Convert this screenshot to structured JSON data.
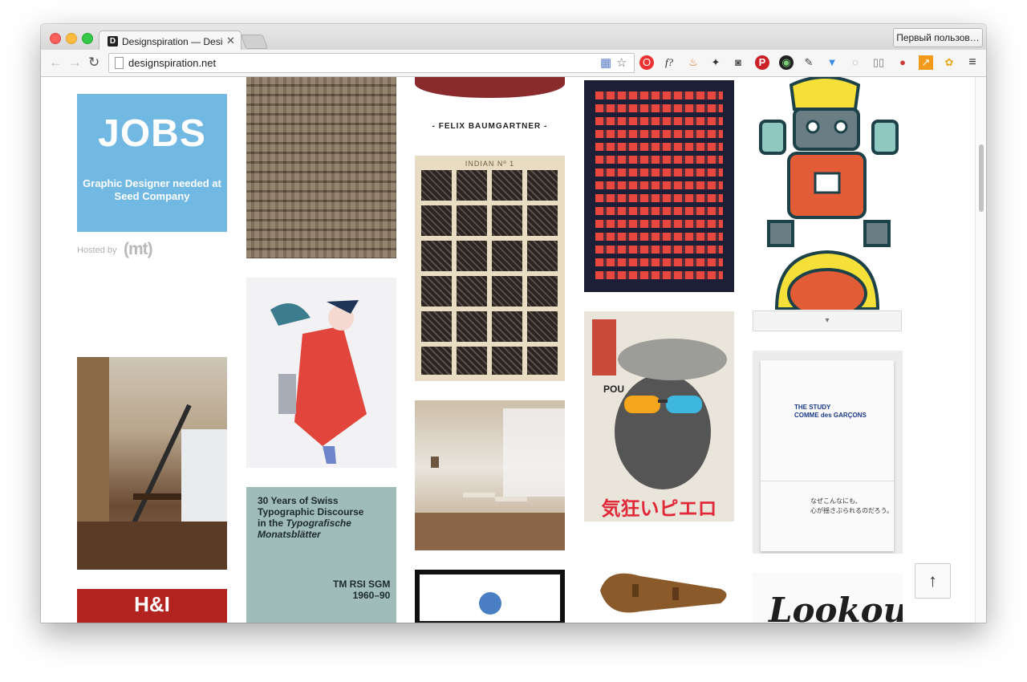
{
  "browser": {
    "tab_title": "Designspiration — Design",
    "tab_favicon": "D",
    "tab_close": "✕",
    "profile_button": "Первый пользов…",
    "url": "designspiration.net",
    "nav": {
      "back": "←",
      "forward": "→",
      "reload": "↻"
    },
    "extensions": [
      "f?",
      "≡"
    ]
  },
  "jobs_card": {
    "title": "JOBS",
    "description_line1": "Graphic Designer needed at",
    "description_line2": "Seed Company",
    "hosted_label": "Hosted by",
    "hosted_logo": "(mt)"
  },
  "tiles": {
    "baumgartner_caption": "- FELIX BAUMGARTNER -",
    "indian_header": "INDIAN Nº 1",
    "swiss_book": {
      "line1": "30 Years of Swiss",
      "line2": "Typographic Discourse",
      "line3": "in the",
      "line3_italic": "Typografische",
      "line4": "Monatsblätter",
      "meta1": "TM RSI SGM",
      "meta2": "1960–90"
    },
    "comme_book": {
      "line1": "THE STUDY",
      "line2": "COMME des GARÇONS",
      "jp1": "なぜこんなにも、",
      "jp2": "心が揺さぶられるのだろう。"
    },
    "poster_jp_title": "気狂いピエロ",
    "poster_pou": "POU",
    "lookout": "Lookout",
    "hal": "H&I"
  },
  "load_more": "▾",
  "scroll_top_button": "↑",
  "colors": {
    "jobs_bg": "#71b8e2",
    "pattern_bg": "#1c2037",
    "pattern_red": "#e8483f",
    "swiss_bg": "#9fbcb9"
  }
}
